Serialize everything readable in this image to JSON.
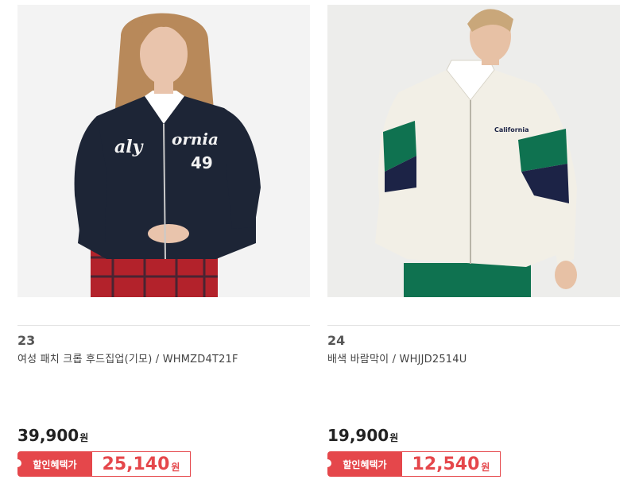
{
  "products": [
    {
      "rank": "23",
      "name": "여성 패치 크롭 후드집업(기모) / WHMZD4T21F",
      "price": "39,900",
      "price_unit": "원",
      "benefit_label": "할인혜택가",
      "benefit_price": "25,140",
      "benefit_unit": "원",
      "image_text": [
        "aly",
        "ornia",
        "49"
      ],
      "colors": {
        "background": "#f3f3f3",
        "hoodie": "#1d2536",
        "skirt": "#b3222b",
        "hair": "#b8895a",
        "skin": "#e9c4ac"
      }
    },
    {
      "rank": "24",
      "name": "배색 바람막이 / WHJJD2514U",
      "price": "19,900",
      "price_unit": "원",
      "benefit_label": "할인혜택가",
      "benefit_price": "12,540",
      "benefit_unit": "원",
      "image_text": [
        "California"
      ],
      "colors": {
        "background": "#ededeb",
        "jacket": "#f2efe6",
        "green": "#0f7250",
        "navy": "#1c2346",
        "hair": "#c9a77a",
        "skin": "#e7c1a5"
      }
    }
  ],
  "accent_color": "#e5474b"
}
